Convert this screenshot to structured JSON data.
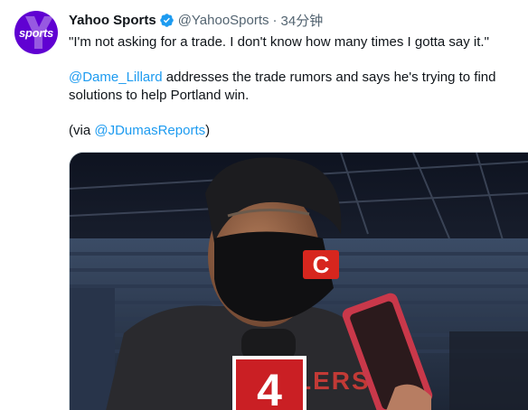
{
  "tweet": {
    "avatar_text": "sports",
    "author_name": "Yahoo Sports",
    "handle": "@YahooSports",
    "separator": "·",
    "timestamp": "34分钟",
    "quote_line": "\"I'm not asking for a trade. I don't know how many times I gotta say it.\"",
    "mention_1": "@Dame_Lillard",
    "body_line_1_rest": " addresses the trade rumors and says he's trying to find",
    "body_line_2": "solutions to help Portland win.",
    "via_open": "(via ",
    "mention_2": "@JDumasReports",
    "via_close": ")"
  },
  "media": {
    "mic_flag_number": "4",
    "mask_logo_letter": "C",
    "shirt_text": "LERS"
  },
  "colors": {
    "brand_purple": "#6001d2",
    "link_blue": "#1d9bf0",
    "verified_blue": "#1d9bf0",
    "secondary_text": "#536471"
  }
}
